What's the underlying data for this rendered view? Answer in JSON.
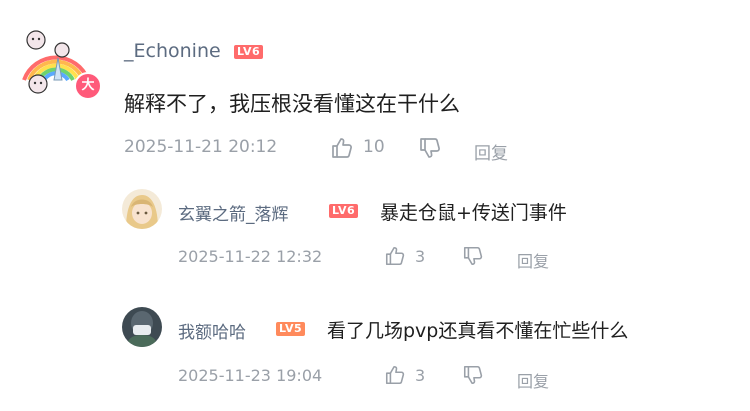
{
  "comments": [
    {
      "username": "_Echonine",
      "level": "LV6",
      "text": "解释不了，我压根没看懂这在干什么",
      "timestamp": "2025-11-21 20:12",
      "likes": "10",
      "reply_label": "回复",
      "badge": "大"
    }
  ],
  "replies": [
    {
      "username": "玄翼之箭_落辉",
      "level": "LV6",
      "text": "暴走仓鼠+传送门事件",
      "timestamp": "2025-11-22 12:32",
      "likes": "3",
      "reply_label": "回复"
    },
    {
      "username": "我额哈哈",
      "level": "LV5",
      "text": "看了几场pvp还真看不懂在忙些什么",
      "timestamp": "2025-11-23 19:04",
      "likes": "3",
      "reply_label": "回复"
    }
  ],
  "icons": {
    "like": "thumbs-up-icon",
    "dislike": "thumbs-down-icon"
  },
  "colors": {
    "level_lv6": "#ff6b6b",
    "level_lv5": "#ff8a5c",
    "username": "#5c6b80",
    "meta": "#9aa0a8"
  }
}
